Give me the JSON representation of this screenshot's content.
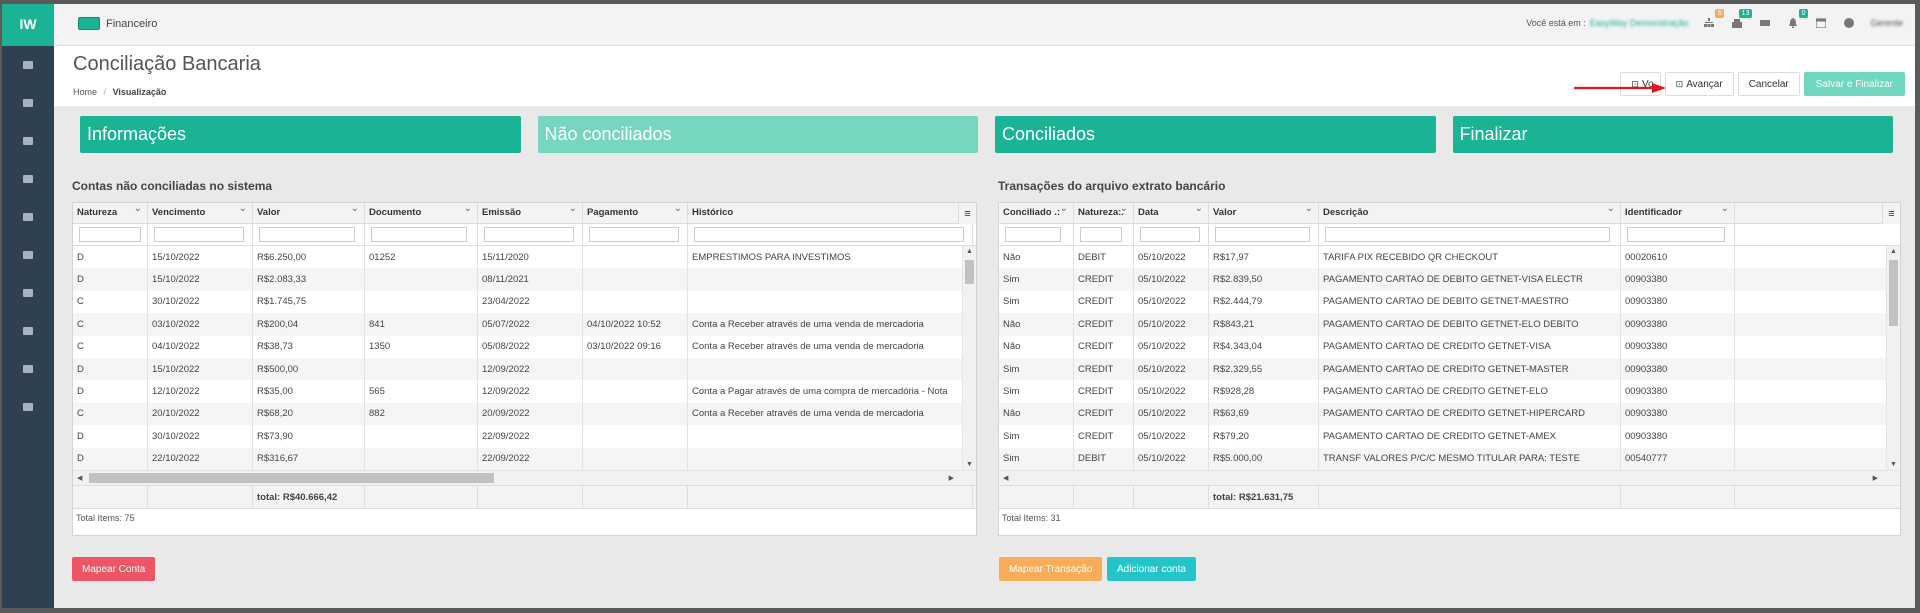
{
  "app": {
    "logo": "IW"
  },
  "sidebar": {
    "icons": [
      "person-icon",
      "cloud-icon",
      "cloud-upload-icon",
      "card-icon",
      "bar-chart-icon",
      "book-icon",
      "list-icon",
      "card-alt-icon",
      "document-icon",
      "copy-icon"
    ]
  },
  "topbar": {
    "module": "Financeiro",
    "location_label": "Você está em :",
    "company": "EasyWay Demonstração",
    "user": "Gerente",
    "badges": {
      "sitemap": "5",
      "building": "13",
      "bell": "0"
    },
    "badge_colors": {
      "orange": "#f8ac59",
      "teal": "#1ab394"
    }
  },
  "page": {
    "title": "Conciliação Bancaria",
    "breadcrumb": {
      "home": "Home",
      "separator": "/",
      "current": "Visualização"
    }
  },
  "actions": {
    "voltar": "Vo",
    "avancar": "Avançar",
    "cancelar": "Cancelar",
    "salvar": "Salvar e Finalizar"
  },
  "steps": [
    "Informações",
    "Não conciliados",
    "Conciliados",
    "Finalizar"
  ],
  "left": {
    "title": "Contas não conciliadas no sistema",
    "columns": [
      "Natureza",
      "Vencimento",
      "Valor",
      "Documento",
      "Emissão",
      "Pagamento",
      "Histórico"
    ],
    "rows": [
      [
        "D",
        "15/10/2022",
        "R$6.250,00",
        "01252",
        "15/11/2020",
        "",
        "EMPRESTIMOS PARA INVESTIMOS"
      ],
      [
        "D",
        "15/10/2022",
        "R$2.083,33",
        "",
        "08/11/2021",
        "",
        ""
      ],
      [
        "C",
        "30/10/2022",
        "R$1.745,75",
        "",
        "23/04/2022",
        "",
        ""
      ],
      [
        "C",
        "03/10/2022",
        "R$200,04",
        "841",
        "05/07/2022",
        "04/10/2022 10:52",
        "Conta a Receber através de uma venda de mercadoria"
      ],
      [
        "C",
        "04/10/2022",
        "R$38,73",
        "1350",
        "05/08/2022",
        "03/10/2022 09:16",
        "Conta a Receber através de uma venda de mercadoria"
      ],
      [
        "D",
        "15/10/2022",
        "R$500,00",
        "",
        "12/09/2022",
        "",
        ""
      ],
      [
        "D",
        "12/10/2022",
        "R$35,00",
        "565",
        "12/09/2022",
        "",
        "Conta a Pagar através de uma compra de mercadória - Nota"
      ],
      [
        "C",
        "20/10/2022",
        "R$68,20",
        "882",
        "20/09/2022",
        "",
        "Conta a Receber através de uma venda de mercadoria"
      ],
      [
        "D",
        "30/10/2022",
        "R$73,90",
        "",
        "22/09/2022",
        "",
        ""
      ],
      [
        "D",
        "22/10/2022",
        "R$316,67",
        "",
        "22/09/2022",
        "",
        ""
      ]
    ],
    "footer_total": "total: R$40.666,42",
    "total_items": "Total Items: 75"
  },
  "right": {
    "title": "Transações do arquivo extrato bancário",
    "columns": [
      "Conciliado .:",
      "Natureza:.",
      "Data",
      "Valor",
      "Descrição",
      "Identificador"
    ],
    "rows": [
      [
        "Não",
        "DEBIT",
        "05/10/2022",
        "R$17,97",
        "TARIFA PIX RECEBIDO QR CHECKOUT",
        "00020610"
      ],
      [
        "Sim",
        "CREDIT",
        "05/10/2022",
        "R$2.839,50",
        "PAGAMENTO CARTAO DE DEBITO GETNET-VISA ELECTR",
        "00903380"
      ],
      [
        "Sim",
        "CREDIT",
        "05/10/2022",
        "R$2.444,79",
        "PAGAMENTO CARTAO DE DEBITO GETNET-MAESTRO",
        "00903380"
      ],
      [
        "Não",
        "CREDIT",
        "05/10/2022",
        "R$843,21",
        "PAGAMENTO CARTAO DE DEBITO GETNET-ELO DEBITO",
        "00903380"
      ],
      [
        "Não",
        "CREDIT",
        "05/10/2022",
        "R$4.343,04",
        "PAGAMENTO CARTAO DE CREDITO GETNET-VISA",
        "00903380"
      ],
      [
        "Sim",
        "CREDIT",
        "05/10/2022",
        "R$2.329,55",
        "PAGAMENTO CARTAO DE CREDITO GETNET-MASTER",
        "00903380"
      ],
      [
        "Sim",
        "CREDIT",
        "05/10/2022",
        "R$928,28",
        "PAGAMENTO CARTAO DE CREDITO GETNET-ELO",
        "00903380"
      ],
      [
        "Não",
        "CREDIT",
        "05/10/2022",
        "R$63,69",
        "PAGAMENTO CARTAO DE CREDITO GETNET-HIPERCARD",
        "00903380"
      ],
      [
        "Sim",
        "CREDIT",
        "05/10/2022",
        "R$79,20",
        "PAGAMENTO CARTAO DE CREDITO GETNET-AMEX",
        "00903380"
      ],
      [
        "Sim",
        "DEBIT",
        "05/10/2022",
        "R$5.000,00",
        "TRANSF VALORES P/C/C MESMO TITULAR PARA: TESTE",
        "00540777"
      ]
    ],
    "footer_total": "total: R$21.631,75",
    "total_items": "Total Items: 31"
  },
  "buttons": {
    "mapear_conta": "Mapear Conta",
    "mapear_transacao": "Mapear Transação",
    "adicionar_conta": "Adicionar conta"
  },
  "colors": {
    "primary": "#1ab394",
    "primary_light": "#76d6bf",
    "danger": "#ed5565",
    "warning": "#f8ac59",
    "info": "#23c6c8",
    "sidebar": "#2f4050",
    "arrow": "#e0181e"
  }
}
